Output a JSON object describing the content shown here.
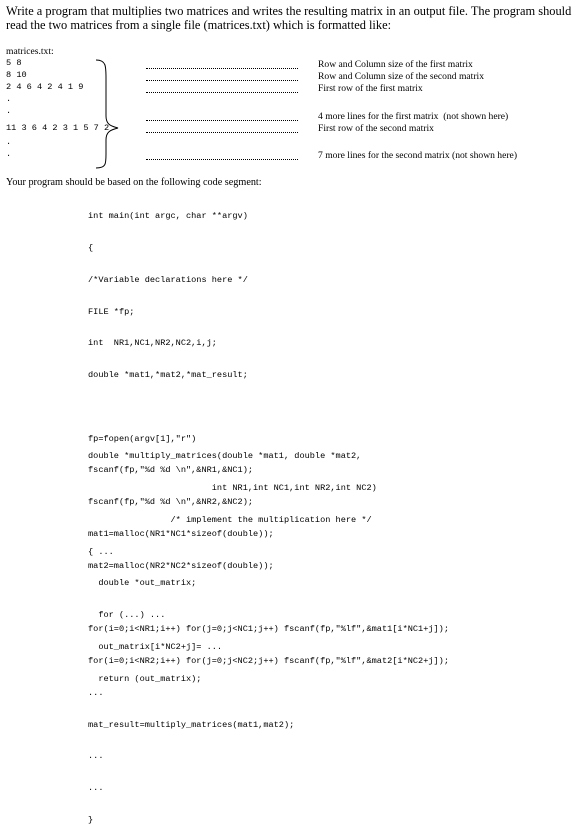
{
  "intro": "Write a program that multiplies two matrices and writes the resulting matrix in an output file. The program should read the two matrices from a single file (matrices.txt) which is formatted like:",
  "file_label": "matrices.txt:",
  "file_lines": [
    "5 8",
    "8 10",
    "2 4 6 4 2 4 1 9",
    ".",
    ".",
    "11 3 6 4 2 3 1 5 7 2",
    ".",
    "."
  ],
  "annotations": [
    "Row and Column size of the first matrix",
    "Row and Column size of the second matrix",
    "First row of the first matrix",
    "4 more lines for the first matrix  (not shown here)",
    "First row of the second matrix",
    "7 more lines for the second matrix (not shown here)"
  ],
  "segment_intro": "Your program should be based on the following code segment:",
  "code_main": [
    "int main(int argc, char **argv)",
    "{",
    "/*Variable declarations here */",
    "FILE *fp;",
    "int  NR1,NC1,NR2,NC2,i,j;",
    "double *mat1,*mat2,*mat_result;",
    "",
    "fp=fopen(argv[1],\"r\")",
    "fscanf(fp,\"%d %d \\n\",&NR1,&NC1);",
    "fscanf(fp,\"%d %d \\n\",&NR2,&NC2);",
    "mat1=malloc(NR1*NC1*sizeof(double));",
    "mat2=malloc(NR2*NC2*sizeof(double));",
    "",
    "for(i=0;i<NR1;i++) for(j=0;j<NC1;j++) fscanf(fp,\"%lf\",&mat1[i*NC1+j]);",
    "for(i=0;i<NR2;i++) for(j=0;j<NC2;j++) fscanf(fp,\"%lf\",&mat2[i*NC2+j]);",
    "...",
    "mat_result=multiply_matrices(mat1,mat2);",
    "...",
    "...",
    "}"
  ],
  "code_func": [
    "double *multiply_matrices(double *mat1, double *mat2,",
    "                        int NR1,int NC1,int NR2,int NC2)",
    "                /* implement the multiplication here */",
    "{ ...",
    "  double *out_matrix;",
    "  for (...) ...",
    "  out_matrix[i*NC2+j]= ...",
    "  return (out_matrix);"
  ]
}
